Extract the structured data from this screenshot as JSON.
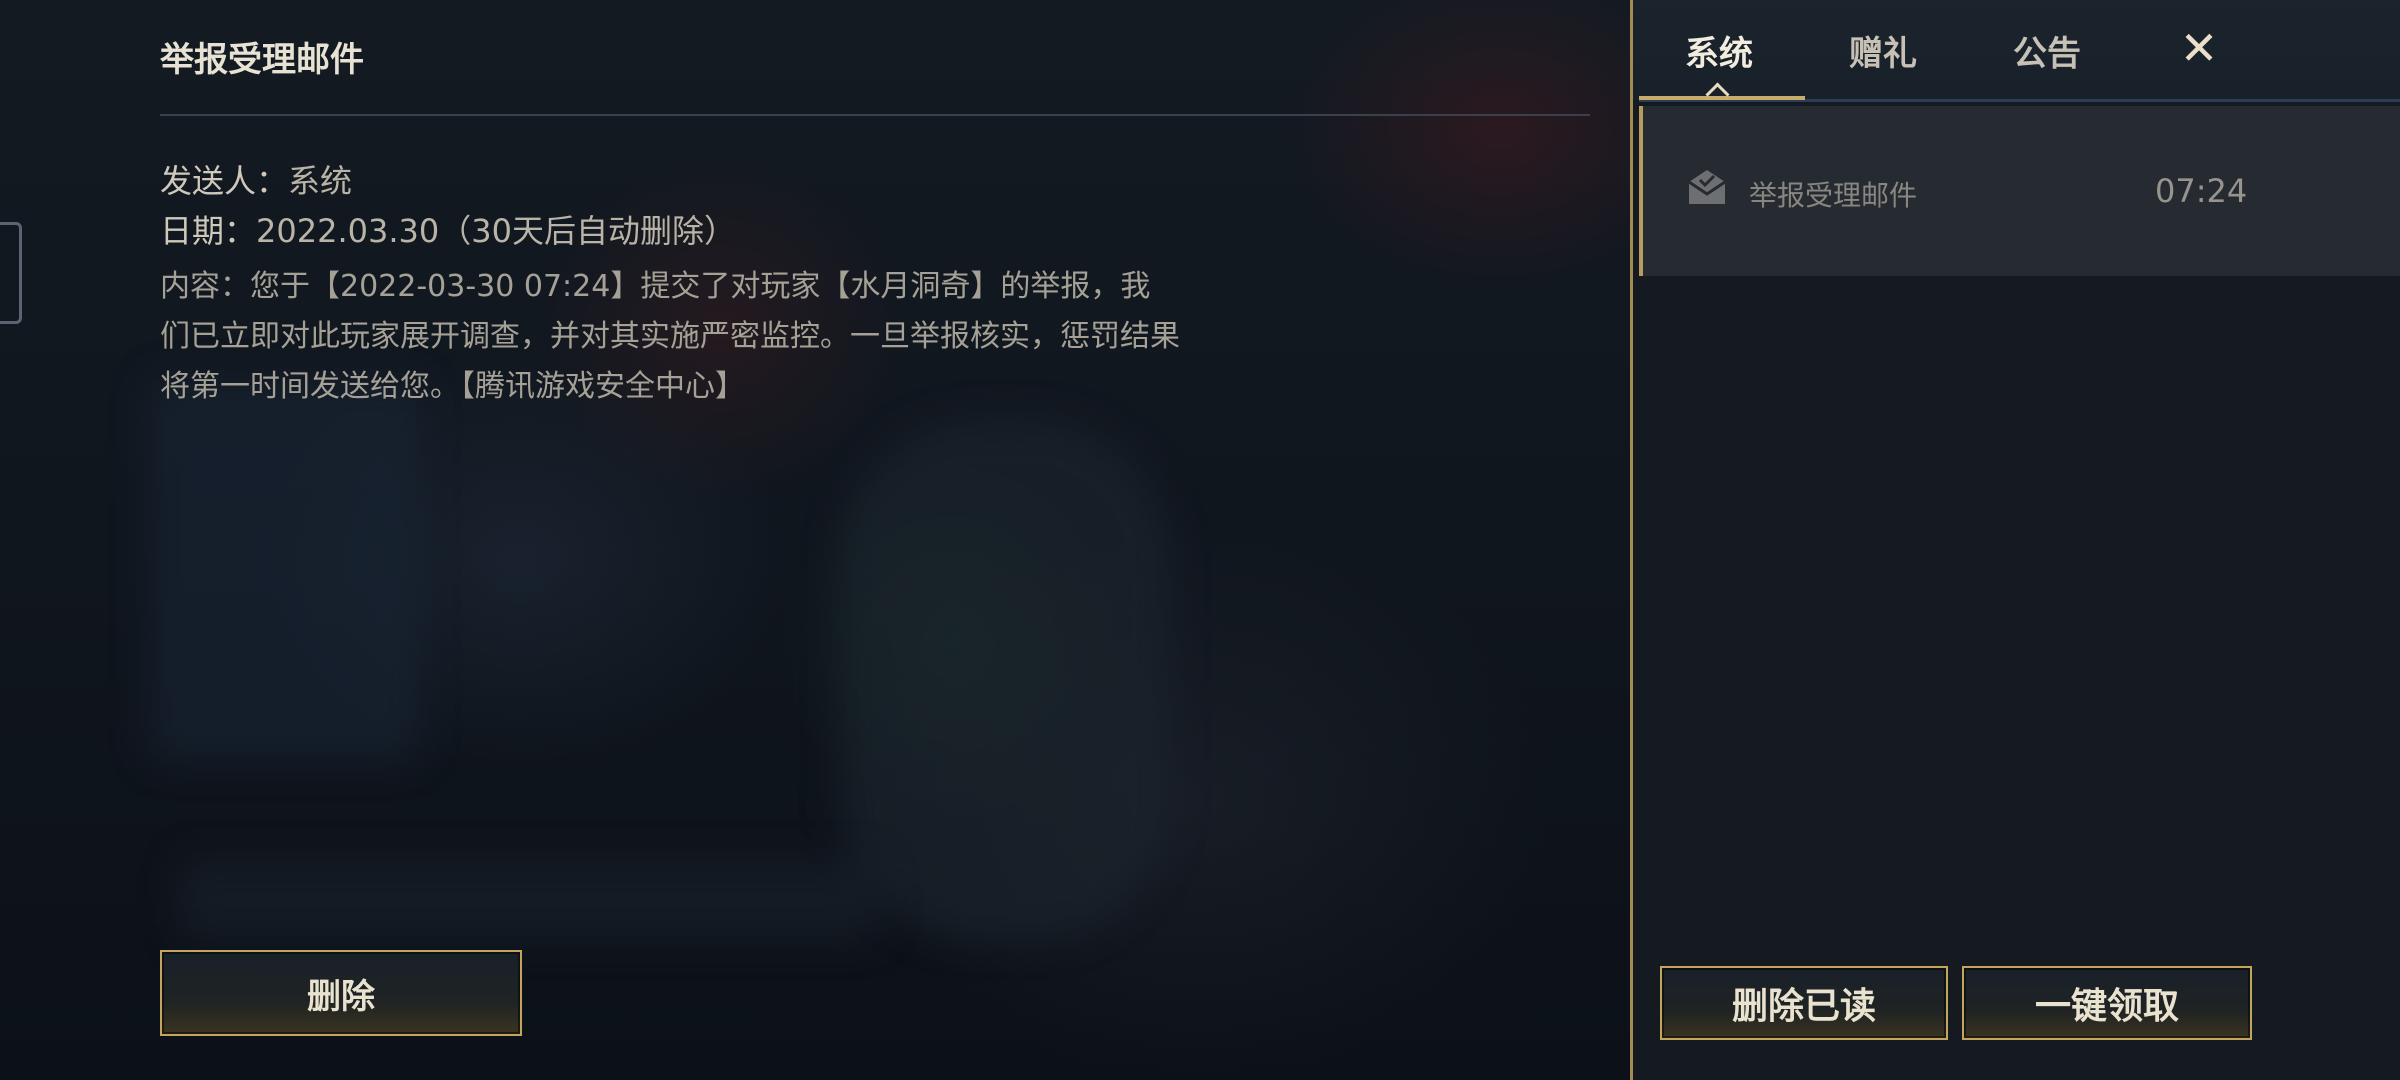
{
  "detail": {
    "title": "举报受理邮件",
    "sender_label": "发送人：",
    "sender_value": "系统",
    "date_label": "日期：",
    "date_value": "2022.03.30（30天后自动删除）",
    "content_label": "内容：",
    "content_lines": [
      "您于【2022-03-30 07:24】提交了对玩家【水月洞奇】的举报，我",
      "们已立即对此玩家展开调查，并对其实施严密监控。一旦举报核实，惩罚结果",
      "将第一时间发送给您。【腾讯游戏安全中心】"
    ],
    "delete_label": "删除"
  },
  "panel": {
    "tabs": [
      {
        "label": "系统",
        "active": true
      },
      {
        "label": "赠礼",
        "active": false
      },
      {
        "label": "公告",
        "active": false
      }
    ],
    "close_label": "✕",
    "mail_list": [
      {
        "icon": "mail-open-icon",
        "subject": "举报受理邮件",
        "time": "07:24"
      }
    ],
    "delete_read_label": "删除已读",
    "collect_all_label": "一键领取"
  },
  "colors": {
    "accent_gold": "#c3a560",
    "panel_bg": "#151a20",
    "selected_item_bg": "#262b32"
  }
}
